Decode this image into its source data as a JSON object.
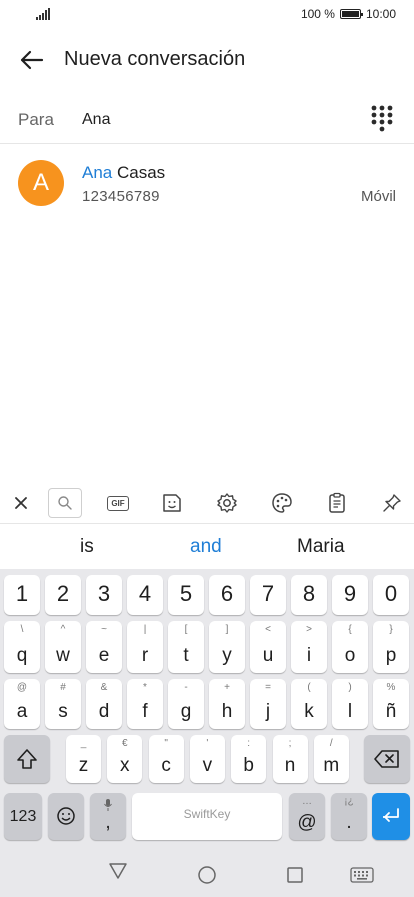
{
  "status_bar": {
    "battery_percent": "100 %",
    "time": "10:00"
  },
  "app_bar": {
    "title": "Nueva conversación"
  },
  "recipient": {
    "label": "Para",
    "value": "Ana"
  },
  "contact": {
    "avatar_letter": "A",
    "name_match": "Ana",
    "name_rest": " Casas",
    "number": "123456789",
    "type": "Móvil",
    "avatar_color": "#f7931e"
  },
  "keyboard_toolbar": {
    "items": [
      "close-icon",
      "search-icon",
      "gif-icon",
      "sticker-icon",
      "settings-icon",
      "theme-palette-icon",
      "clipboard-icon",
      "pin-icon"
    ],
    "gif_label": "GIF"
  },
  "suggestions": [
    "is",
    "and",
    "Maria"
  ],
  "keyboard": {
    "number_row": [
      "1",
      "2",
      "3",
      "4",
      "5",
      "6",
      "7",
      "8",
      "9",
      "0"
    ],
    "row1": {
      "keys": [
        "q",
        "w",
        "e",
        "r",
        "t",
        "y",
        "u",
        "i",
        "o",
        "p"
      ],
      "hints": [
        "\\",
        "^",
        "~",
        "|",
        "[",
        "]",
        "<",
        ">",
        "{",
        "}"
      ]
    },
    "row2": {
      "keys": [
        "a",
        "s",
        "d",
        "f",
        "g",
        "h",
        "j",
        "k",
        "l",
        "ñ"
      ],
      "hints": [
        "@",
        "#",
        "&",
        "*",
        "-",
        "+",
        "=",
        "(",
        ")",
        "%"
      ]
    },
    "row3": {
      "keys": [
        "z",
        "x",
        "c",
        "v",
        "b",
        "n",
        "m"
      ],
      "hints": [
        "_",
        "€",
        "\"",
        "'",
        ":",
        ";",
        "/"
      ]
    },
    "bottom": {
      "symbols_label": "123",
      "comma": ",",
      "space_brand": "SwiftKey",
      "at": "@",
      "at_hint": "…",
      "period": ".",
      "period_hint": "¡¿"
    },
    "accent_color": "#1f8fe6"
  },
  "nav_bar": {
    "buttons": [
      "back-triangle-icon",
      "home-circle-icon",
      "recents-square-icon",
      "keyboard-icon"
    ]
  }
}
